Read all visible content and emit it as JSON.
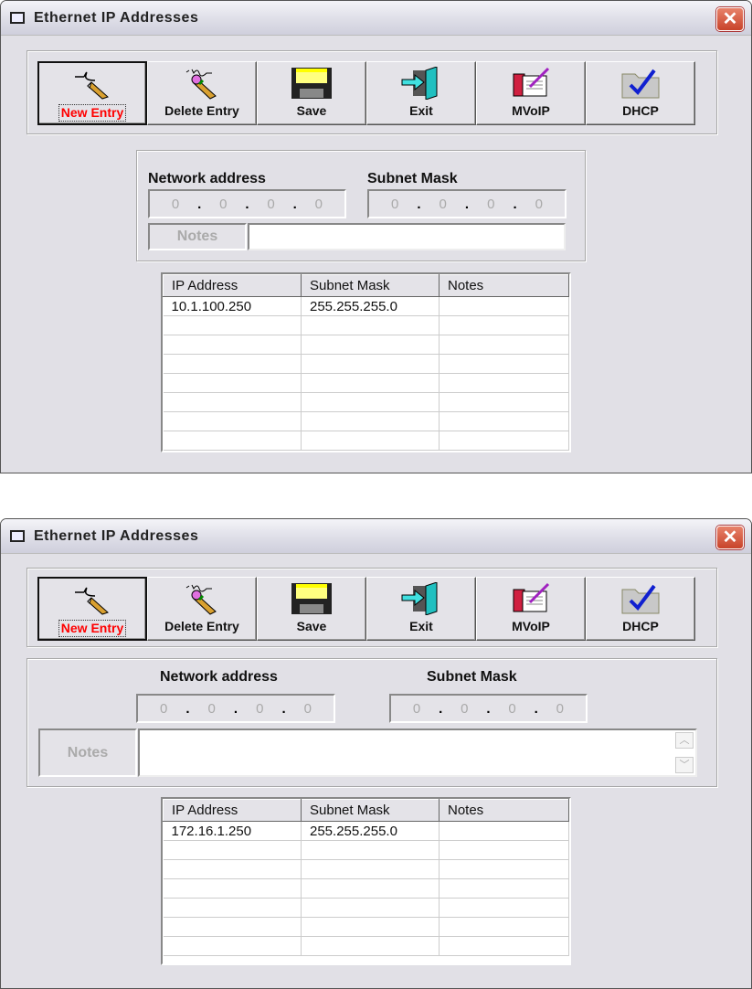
{
  "windows": [
    {
      "title": "Ethernet IP Addresses",
      "toolbar": [
        "New Entry",
        "Delete Entry",
        "Save",
        "Exit",
        "MVoIP",
        "DHCP"
      ],
      "network_label": "Network address",
      "subnet_label": "Subnet Mask",
      "network_value": [
        "0",
        "0",
        "0",
        "0"
      ],
      "subnet_value": [
        "0",
        "0",
        "0",
        "0"
      ],
      "notes_label": "Notes",
      "notes_value": "",
      "table": {
        "headers": [
          "IP Address",
          "Subnet Mask",
          "Notes"
        ],
        "rows": [
          [
            "10.1.100.250",
            "255.255.255.0",
            ""
          ]
        ]
      }
    },
    {
      "title": "Ethernet IP Addresses",
      "toolbar": [
        "New Entry",
        "Delete Entry",
        "Save",
        "Exit",
        "MVoIP",
        "DHCP"
      ],
      "network_label": "Network address",
      "subnet_label": "Subnet Mask",
      "network_value": [
        "0",
        "0",
        "0",
        "0"
      ],
      "subnet_value": [
        "0",
        "0",
        "0",
        "0"
      ],
      "notes_label": "Notes",
      "notes_value": "",
      "table": {
        "headers": [
          "IP Address",
          "Subnet Mask",
          "Notes"
        ],
        "rows": [
          [
            "172.16.1.250",
            "255.255.255.0",
            ""
          ]
        ]
      }
    }
  ],
  "colors": {
    "default_button_text": "#ff0000",
    "close": "#c8432a"
  }
}
